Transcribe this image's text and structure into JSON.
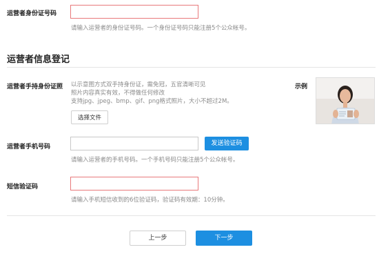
{
  "id_number": {
    "label": "运营者身份证号码",
    "value": "",
    "hint": "请输入运营者的身份证号码。一个身份证号码只能注册5个公众帐号。"
  },
  "section": {
    "title": "运营者信息登记"
  },
  "handheld_photo": {
    "label": "运营者手持身份证照",
    "desc_line1": "以示意图方式双手持身份证，需免冠，五官清晰可见",
    "desc_line2": "照片内容真实有效，不得做任何修改",
    "desc_line3": "支持jpg、jpeg、bmp、gif、png格式照片，大小不超过2M。",
    "choose_file_label": "选择文件",
    "example_label": "示例"
  },
  "phone": {
    "label": "运营者手机号码",
    "value": "",
    "send_code_label": "发送验证码",
    "hint": "请输入运营者的手机号码。一个手机号码只能注册5个公众帐号。"
  },
  "sms_code": {
    "label": "短信验证码",
    "value": "",
    "hint": "请输入手机短信收到的6位验证码，验证码有效期：10分钟。"
  },
  "footer": {
    "prev_label": "上一步",
    "next_label": "下一步"
  },
  "colors": {
    "accent": "#1d8fe1",
    "error_border": "#e8787a"
  }
}
